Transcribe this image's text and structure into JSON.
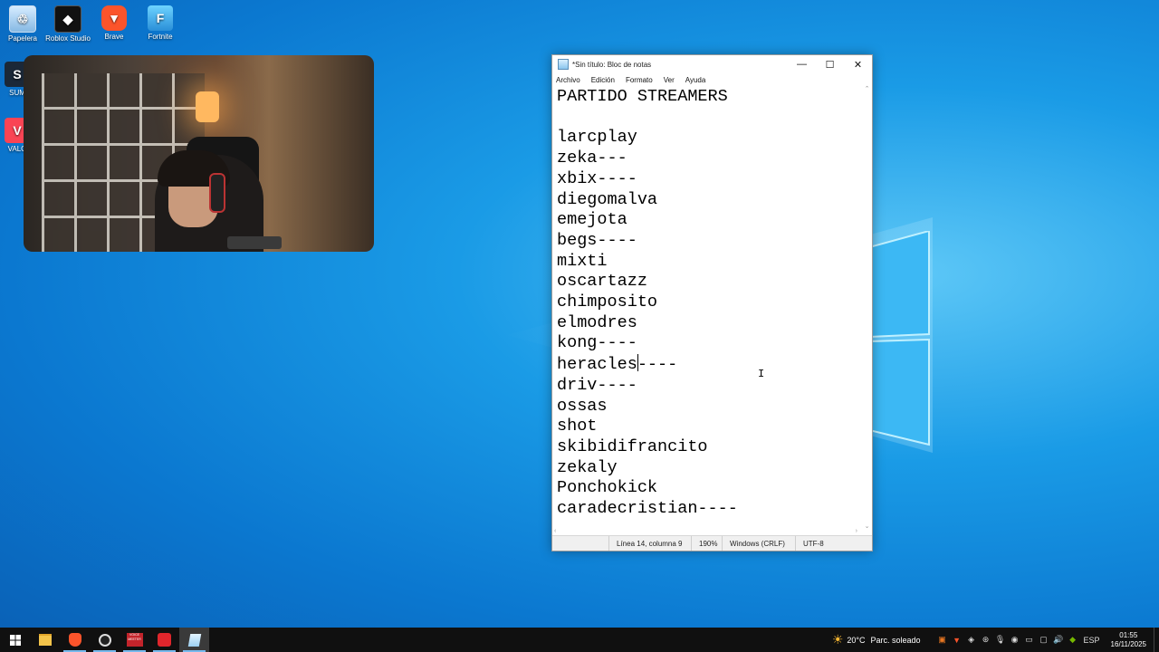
{
  "desktop": {
    "icons": [
      {
        "label": "Papelera",
        "icon": "recycle-bin-icon"
      },
      {
        "label": "Roblox Studio",
        "icon": "roblox-studio-icon"
      },
      {
        "label": "Brave",
        "icon": "brave-icon"
      },
      {
        "label": "Fortnite",
        "icon": "fortnite-icon"
      },
      {
        "label": "SUM",
        "icon": "steam-icon"
      },
      {
        "label": "VALO",
        "icon": "valorant-icon"
      }
    ]
  },
  "notepad": {
    "title": "*Sin título: Bloc de notas",
    "menu": [
      "Archivo",
      "Edición",
      "Formato",
      "Ver",
      "Ayuda"
    ],
    "lines": [
      "PARTIDO STREAMERS",
      "",
      "larcplay",
      "zeka---",
      "xbix----",
      "diegomalva",
      "emejota",
      "begs----",
      "mixti",
      "oscartazz",
      "chimposito",
      "elmodres",
      "kong----"
    ],
    "caret_line_before": "heracles",
    "caret_line_after": "----",
    "lines_after": [
      "driv----",
      "ossas",
      "shot",
      "skibidifrancito",
      "zekaly",
      "Ponchokick",
      "caradecristian----"
    ],
    "status": {
      "position": "Línea 14, columna 9",
      "zoom": "190%",
      "eol": "Windows (CRLF)",
      "encoding": "UTF-8"
    }
  },
  "taskbar": {
    "apps": [
      "start-icon",
      "file-explorer-icon",
      "brave-icon",
      "obs-icon",
      "voicemeeter-icon",
      "streamlabs-icon",
      "notepad-icon"
    ],
    "voicemeeter_label": "VOICE MEETER",
    "weather": {
      "temp": "20°C",
      "desc": "Parc. soleado"
    },
    "language": "ESP",
    "time": "01:55",
    "date": "16/11/2025"
  },
  "colors": {
    "accent": "#0078d7",
    "taskbar": "#101010"
  }
}
